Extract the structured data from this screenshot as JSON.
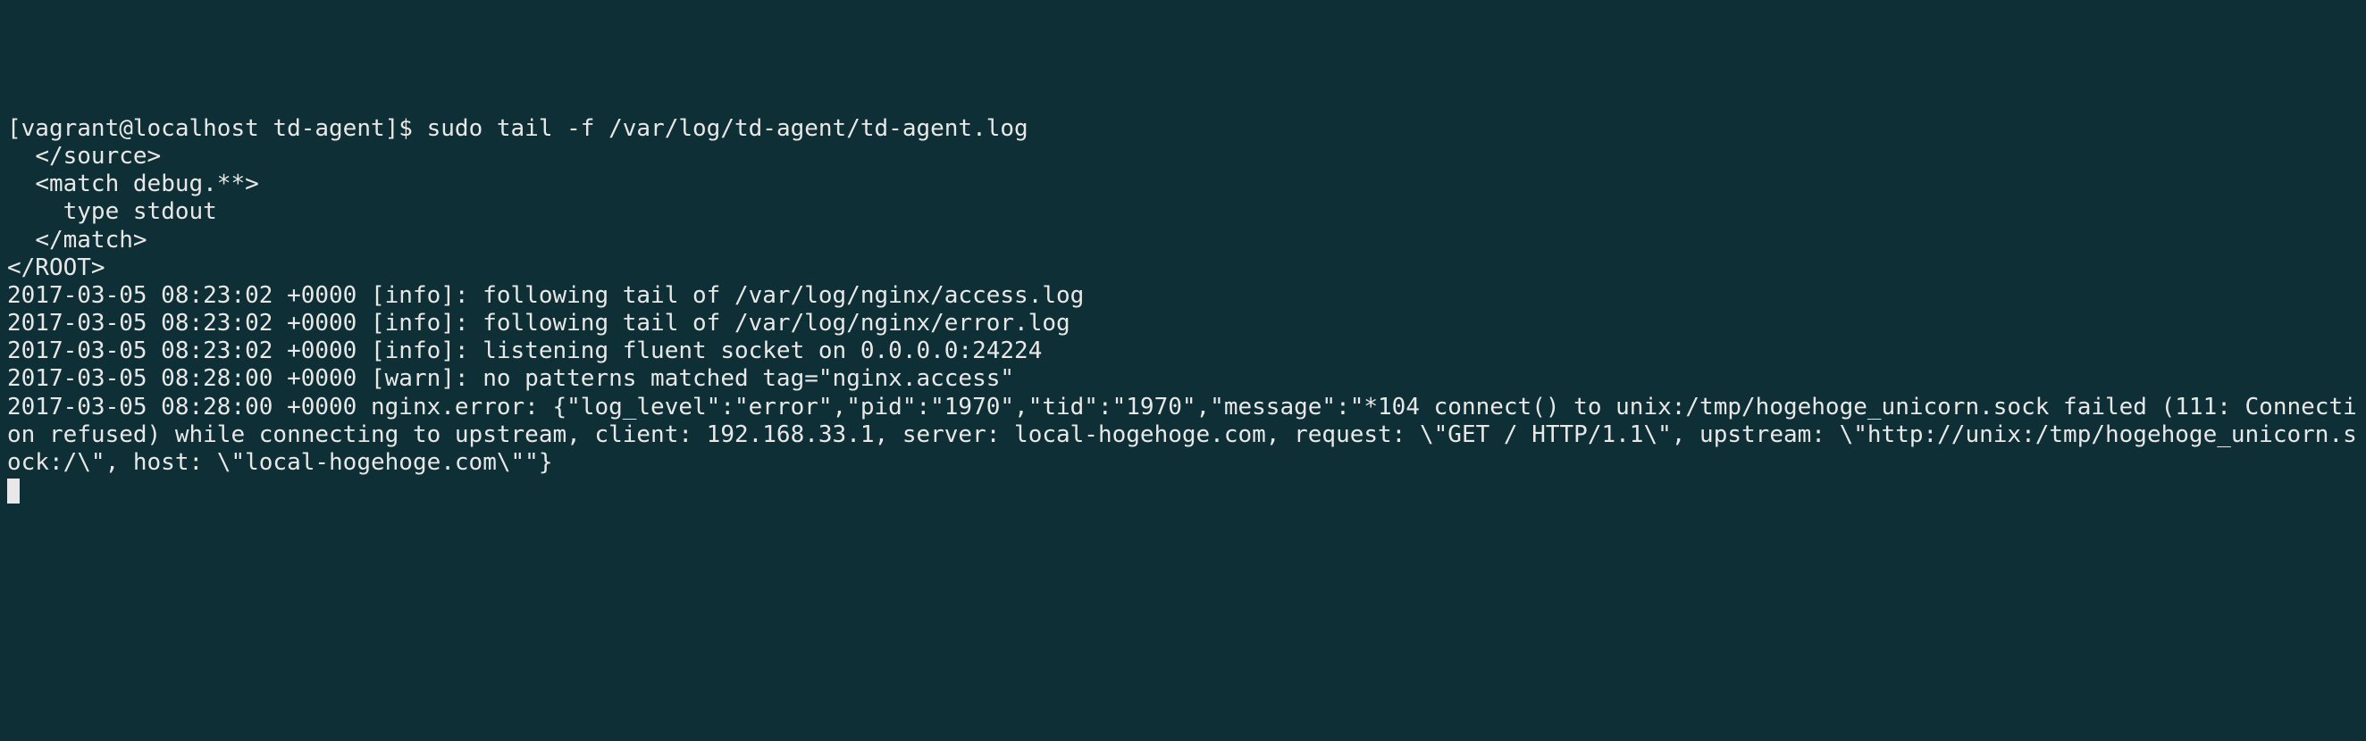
{
  "terminal": {
    "prompt": "[vagrant@localhost td-agent]$ ",
    "command": "sudo tail -f /var/log/td-agent/td-agent.log",
    "lines": [
      "  </source>",
      "  <match debug.**>",
      "    type stdout",
      "  </match>",
      "</ROOT>",
      "2017-03-05 08:23:02 +0000 [info]: following tail of /var/log/nginx/access.log",
      "2017-03-05 08:23:02 +0000 [info]: following tail of /var/log/nginx/error.log",
      "2017-03-05 08:23:02 +0000 [info]: listening fluent socket on 0.0.0.0:24224",
      "2017-03-05 08:28:00 +0000 [warn]: no patterns matched tag=\"nginx.access\"",
      "2017-03-05 08:28:00 +0000 nginx.error: {\"log_level\":\"error\",\"pid\":\"1970\",\"tid\":\"1970\",\"message\":\"*104 connect() to unix:/tmp/hogehoge_unicorn.sock failed (111: Connection refused) while connecting to upstream, client: 192.168.33.1, server: local-hogehoge.com, request: \\\"GET / HTTP/1.1\\\", upstream: \\\"http://unix:/tmp/hogehoge_unicorn.sock:/\\\", host: \\\"local-hogehoge.com\\\"\"}"
    ]
  }
}
